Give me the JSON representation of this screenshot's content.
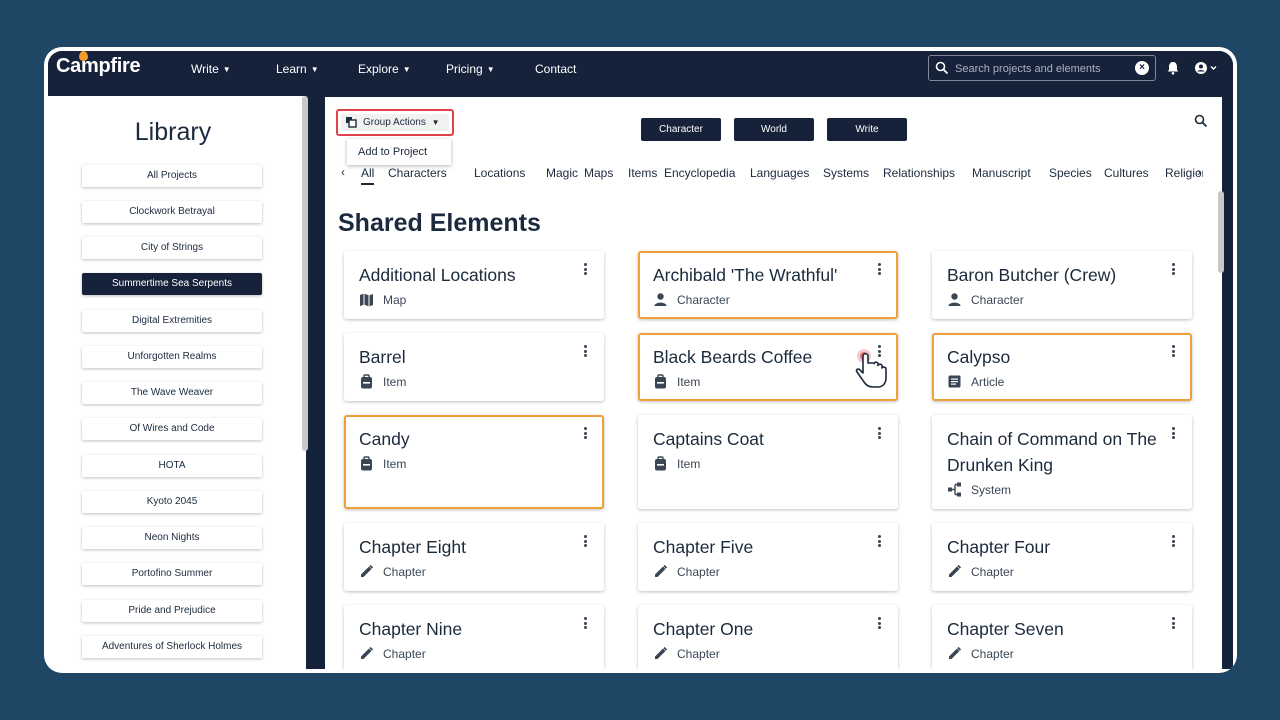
{
  "nav": {
    "logo": "Campfire",
    "items": [
      {
        "label": "Write",
        "has_menu": true
      },
      {
        "label": "Learn",
        "has_menu": true
      },
      {
        "label": "Explore",
        "has_menu": true
      },
      {
        "label": "Pricing",
        "has_menu": true
      },
      {
        "label": "Contact",
        "has_menu": false
      }
    ],
    "search_placeholder": "Search projects and elements"
  },
  "library": {
    "title": "Library",
    "items": [
      {
        "label": "All Projects",
        "active": false
      },
      {
        "label": "Clockwork Betrayal",
        "active": false
      },
      {
        "label": "City of Strings",
        "active": false
      },
      {
        "label": "Summertime Sea Serpents",
        "active": true
      },
      {
        "label": "Digital Extremities",
        "active": false
      },
      {
        "label": "Unforgotten Realms",
        "active": false
      },
      {
        "label": "The Wave Weaver",
        "active": false
      },
      {
        "label": "Of Wires and Code",
        "active": false
      },
      {
        "label": "HOTA",
        "active": false
      },
      {
        "label": "Kyoto 2045",
        "active": false
      },
      {
        "label": "Neon Nights",
        "active": false
      },
      {
        "label": "Portofino Summer",
        "active": false
      },
      {
        "label": "Pride and Prejudice",
        "active": false
      },
      {
        "label": "Adventures of Sherlock Holmes",
        "active": false
      }
    ]
  },
  "toolbar": {
    "group_actions_label": "Group Actions",
    "menu_items": [
      "Add to Project"
    ],
    "type_buttons": [
      "Character",
      "World",
      "Write"
    ]
  },
  "tabs": [
    "All",
    "Characters",
    "Locations",
    "Magic",
    "Maps",
    "Items",
    "Encyclopedia",
    "Languages",
    "Systems",
    "Relationships",
    "Manuscript",
    "Species",
    "Cultures",
    "Religions"
  ],
  "active_tab": "All",
  "section_title": "Shared Elements",
  "cards": [
    {
      "title": "Additional Locations",
      "type": "Map",
      "icon": "map-icon",
      "selected": false
    },
    {
      "title": "Archibald 'The Wrathful'",
      "type": "Character",
      "icon": "person-icon",
      "selected": true
    },
    {
      "title": "Baron Butcher (Crew)",
      "type": "Character",
      "icon": "person-icon",
      "selected": false
    },
    {
      "title": "Barrel",
      "type": "Item",
      "icon": "backpack-icon",
      "selected": false
    },
    {
      "title": "Black Beards Coffee",
      "type": "Item",
      "icon": "backpack-icon",
      "selected": true
    },
    {
      "title": "Calypso",
      "type": "Article",
      "icon": "article-icon",
      "selected": true
    },
    {
      "title": "Candy",
      "type": "Item",
      "icon": "backpack-icon",
      "selected": true
    },
    {
      "title": "Captains Coat",
      "type": "Item",
      "icon": "backpack-icon",
      "selected": false
    },
    {
      "title": "Chain of Command on The Drunken King",
      "type": "System",
      "icon": "system-icon",
      "selected": false
    },
    {
      "title": "Chapter Eight",
      "type": "Chapter",
      "icon": "pencil-icon",
      "selected": false
    },
    {
      "title": "Chapter Five",
      "type": "Chapter",
      "icon": "pencil-icon",
      "selected": false
    },
    {
      "title": "Chapter Four",
      "type": "Chapter",
      "icon": "pencil-icon",
      "selected": false
    },
    {
      "title": "Chapter Nine",
      "type": "Chapter",
      "icon": "pencil-icon",
      "selected": false
    },
    {
      "title": "Chapter One",
      "type": "Chapter",
      "icon": "pencil-icon",
      "selected": false
    },
    {
      "title": "Chapter Seven",
      "type": "Chapter",
      "icon": "pencil-icon",
      "selected": false
    }
  ],
  "colors": {
    "background": "#1e4766",
    "nav": "#16223a",
    "selected_border": "#f0a03a",
    "group_actions_highlight": "#e0434b"
  }
}
